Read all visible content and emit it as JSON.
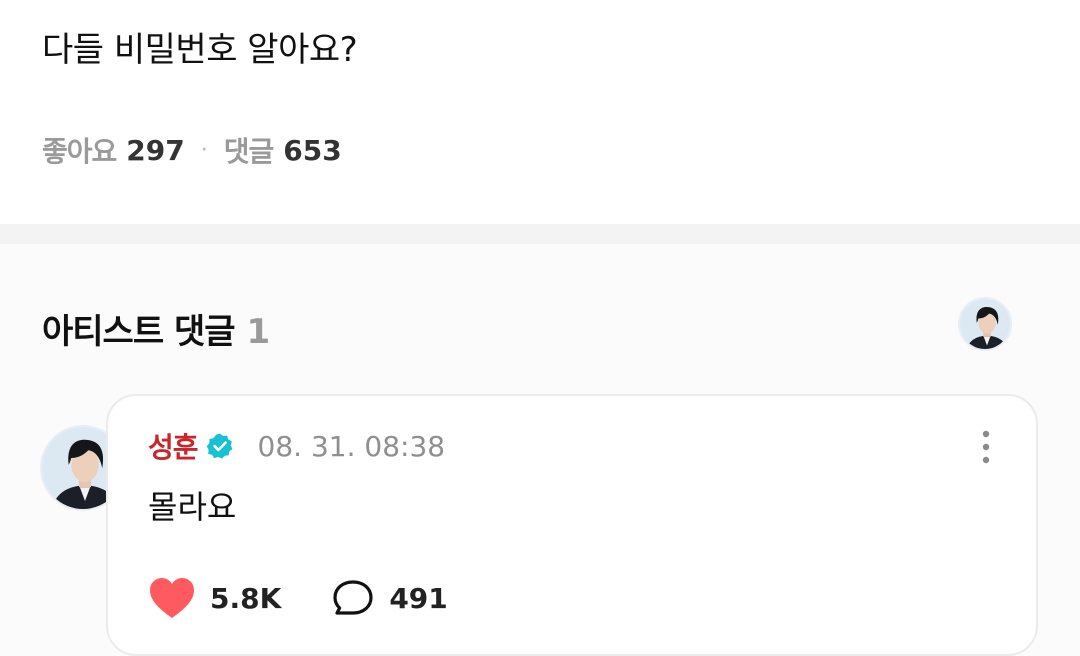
{
  "post": {
    "title": "다들 비밀번호 알아요?",
    "likes_label": "좋아요",
    "likes_count": "297",
    "separator": "·",
    "comments_label": "댓글",
    "comments_count": "653"
  },
  "artist_comments": {
    "title": "아티스트 댓글",
    "count": "1",
    "filter_avatar_icon": "artist-avatar",
    "comment": {
      "author": "성훈",
      "verified_icon": "verified-badge-icon",
      "verified_color": "#19c0d2",
      "timestamp": "08. 31. 08:38",
      "body": "몰라요",
      "likes": "5.8K",
      "replies": "491",
      "like_icon": "heart-icon",
      "like_color": "#ff5a5f",
      "reply_icon": "speech-bubble-icon",
      "more_icon": "more-vertical-icon"
    }
  }
}
